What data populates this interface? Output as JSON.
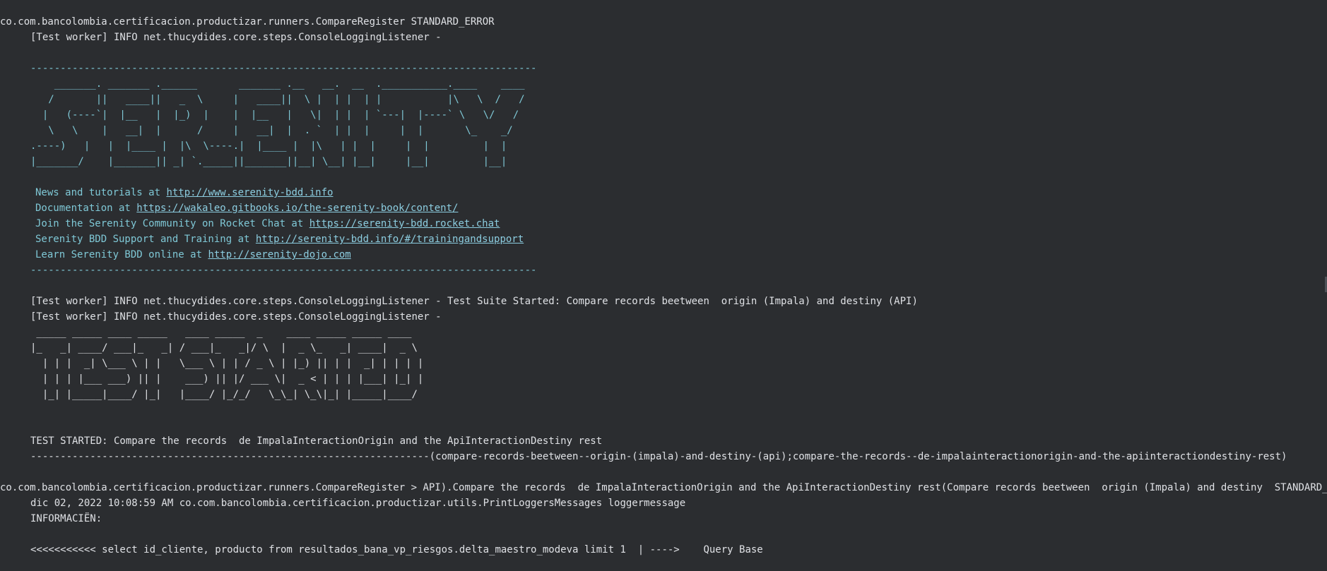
{
  "log": {
    "header_1": "co.com.bancolombia.certificacion.productizar.runners.CompareRegister STANDARD_ERROR",
    "worker_1": "[Test worker] INFO net.thucydides.core.steps.ConsoleLoggingListener -",
    "separator_1": "-------------------------------------------------------------------------------------",
    "serenity_banner": [
      "    _______. _______ .______       _______ .__   __.  __  .___________.____    ____",
      "   /       ||   ____||   _  \\     |   ____||  \\ |  | |  | |           |\\   \\  /   /",
      "  |   (----`|  |__   |  |_)  |    |  |__   |   \\|  | |  | `---|  |----` \\   \\/   /",
      "   \\   \\    |   __|  |      /     |   __|  |  . `  | |  |     |  |       \\_    _/",
      ".----)   |   |  |____ |  |\\  \\----.|  |____ |  |\\   | |  |     |  |         |  |",
      "|_______/    |_______|| _| `._____||_______||__| \\__| |__|     |__|         |__|"
    ],
    "info_links": [
      {
        "prefix": "News and tutorials at ",
        "link": "http://www.serenity-bdd.info"
      },
      {
        "prefix": "Documentation at ",
        "link": "https://wakaleo.gitbooks.io/the-serenity-book/content/"
      },
      {
        "prefix": "Join the Serenity Community on Rocket Chat at ",
        "link": "https://serenity-bdd.rocket.chat"
      },
      {
        "prefix": "Serenity BDD Support and Training at ",
        "link": "http://serenity-bdd.info/#/trainingandsupport"
      },
      {
        "prefix": "Learn Serenity BDD online at ",
        "link": "http://serenity-dojo.com"
      }
    ],
    "separator_2": "-------------------------------------------------------------------------------------",
    "worker_2": "[Test worker] INFO net.thucydides.core.steps.ConsoleLoggingListener - Test Suite Started: Compare records beetween  origin (Impala) and destiny (API)",
    "worker_3": "[Test worker] INFO net.thucydides.core.steps.ConsoleLoggingListener -",
    "test_started_banner": [
      " _____ _____ ____ _____   ____ _____  _    ____ _____ _____ ____",
      "|_   _| ____/ ___|_   _| / ___|_   _|/ \\  |  _ \\_   _| ____|  _ \\",
      "  | | |  _| \\___ \\ | |   \\___ \\ | | / _ \\ | |_) || | |  _| | | | |",
      "  | | | |___ ___) || |    ___) || |/ ___ \\|  _ < | | | |___| |_| |",
      "  |_| |_____|____/ |_|   |____/ |_/_/   \\_\\_| \\_\\|_| |_____|____/"
    ],
    "test_started": "TEST STARTED: Compare the records  de ImpalaInteractionOrigin and the ApiInteractionDestiny rest",
    "test_started_id": "-------------------------------------------------------------------(compare-records-beetween--origin-(impala)-and-destiny-(api);compare-the-records--de-impalainteractionorigin-and-the-apiinteractiondestiny-rest)",
    "header_2": "co.com.bancolombia.certificacion.productizar.runners.CompareRegister > API).Compare the records  de ImpalaInteractionOrigin and the ApiInteractionDestiny rest(Compare records beetween  origin (Impala) and destiny  STANDARD_ERROR",
    "logger_line": "dic 02, 2022 10:08:59 AM co.com.bancolombia.certificacion.productizar.utils.PrintLoggersMessages loggermessage",
    "info_label": "INFORMACIËN:",
    "query_line": "<<<<<<<<<<< select id_cliente, producto from resultados_bana_vp_riesgos.delta_maestro_modeva limit 1  | ---->    Query Base"
  }
}
